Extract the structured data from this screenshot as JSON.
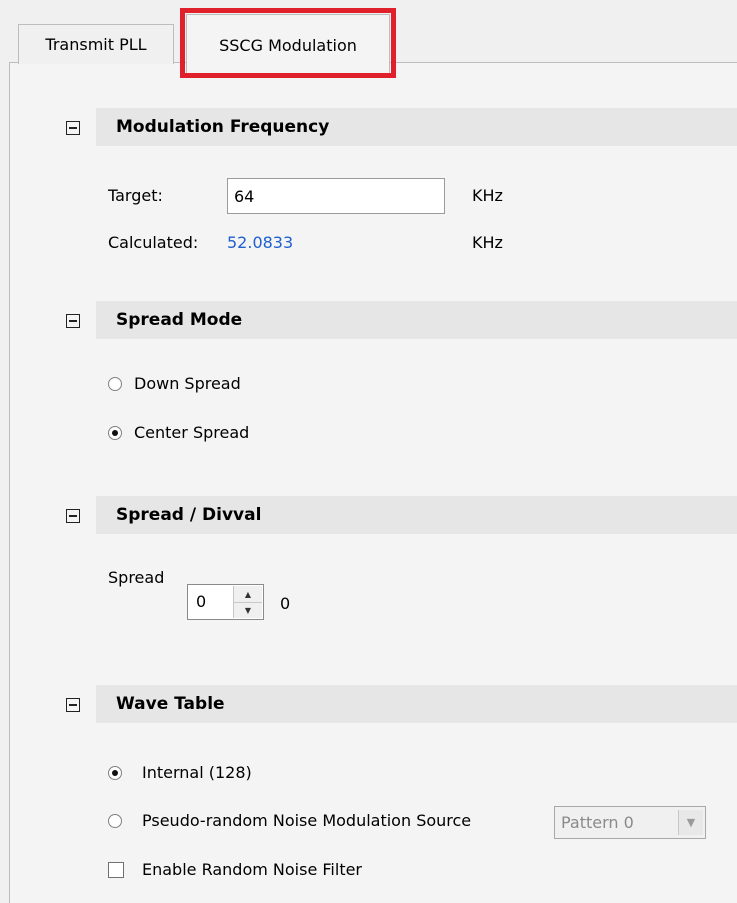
{
  "tabs": [
    {
      "label": "Transmit PLL"
    },
    {
      "label": "SSCG Modulation"
    }
  ],
  "sections": {
    "modulation_frequency": {
      "title": "Modulation Frequency",
      "target_label": "Target:",
      "target_value": "64",
      "target_unit": "KHz",
      "calculated_label": "Calculated:",
      "calculated_value": "52.0833",
      "calculated_unit": "KHz"
    },
    "spread_mode": {
      "title": "Spread Mode",
      "options": [
        {
          "label": "Down Spread",
          "checked": false
        },
        {
          "label": "Center Spread",
          "checked": true
        }
      ]
    },
    "spread_divval": {
      "title": "Spread / Divval",
      "spread_label": "Spread",
      "spread_value": "0",
      "divval_value": "0"
    },
    "wave_table": {
      "title": "Wave Table",
      "options": [
        {
          "label": "Internal (128)",
          "checked": true
        },
        {
          "label": "Pseudo-random Noise Modulation Source",
          "checked": false
        }
      ],
      "pattern_value": "Pattern 0",
      "noise_filter_label": "Enable Random Noise Filter",
      "noise_filter_checked": false
    }
  },
  "colors": {
    "highlight": "#e0202a",
    "calculated_text": "#1f5fcf"
  }
}
